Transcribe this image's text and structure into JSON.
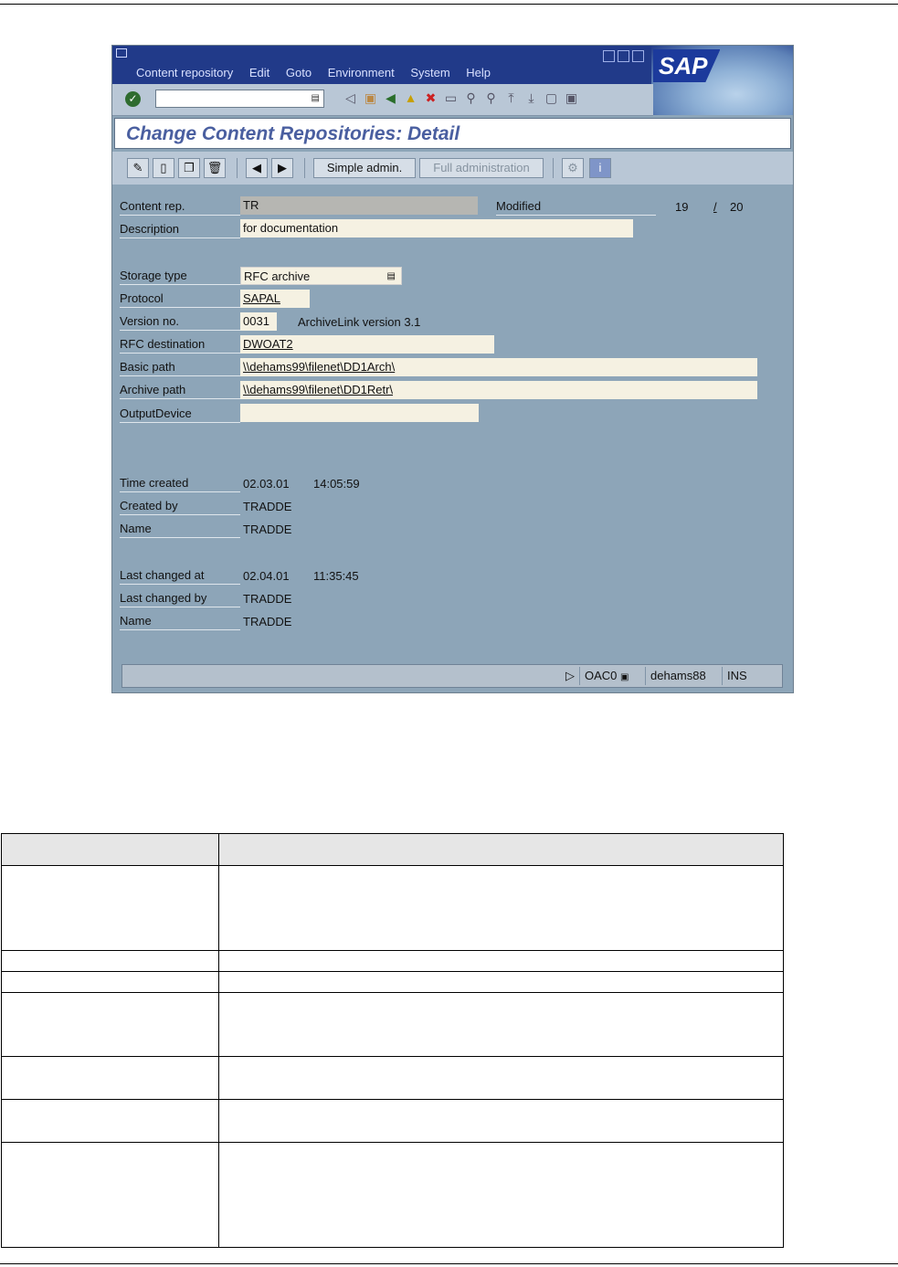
{
  "window": {
    "menu": [
      "Content repository",
      "Edit",
      "Goto",
      "Environment",
      "System",
      "Help"
    ],
    "title": "Change Content Repositories: Detail",
    "logo": "SAP"
  },
  "appbar": {
    "simple_admin": "Simple admin.",
    "full_admin": "Full administration"
  },
  "form": {
    "content_rep": {
      "label": "Content rep.",
      "value": "TR"
    },
    "modified": {
      "label": "Modified",
      "current": "19",
      "slash": "/",
      "total": "20"
    },
    "description": {
      "label": "Description",
      "value": "for documentation"
    },
    "storage_type": {
      "label": "Storage type",
      "value": "RFC archive"
    },
    "protocol": {
      "label": "Protocol",
      "value": "SAPAL"
    },
    "version": {
      "label": "Version no.",
      "value": "0031",
      "note": "ArchiveLink version 3.1"
    },
    "rfc_destination": {
      "label": "RFC destination",
      "value": "DWOAT2"
    },
    "basic_path": {
      "label": "Basic path",
      "value": "\\\\dehams99\\filenet\\DD1Arch\\"
    },
    "archive_path": {
      "label": "Archive path",
      "value": "\\\\dehams99\\filenet\\DD1Retr\\"
    },
    "output_device": {
      "label": "OutputDevice",
      "value": ""
    },
    "time_created": {
      "label": "Time created",
      "date": "02.03.01",
      "time": "14:05:59"
    },
    "created_by": {
      "label": "Created by",
      "value": "TRADDE"
    },
    "name1": {
      "label": "Name",
      "value": "TRADDE"
    },
    "last_changed_at": {
      "label": "Last changed at",
      "date": "02.04.01",
      "time": "11:35:45"
    },
    "last_changed_by": {
      "label": "Last changed by",
      "value": "TRADDE"
    },
    "name2": {
      "label": "Name",
      "value": "TRADDE"
    }
  },
  "status": {
    "transaction": "OAC0",
    "server": "dehams88",
    "mode": "INS"
  }
}
